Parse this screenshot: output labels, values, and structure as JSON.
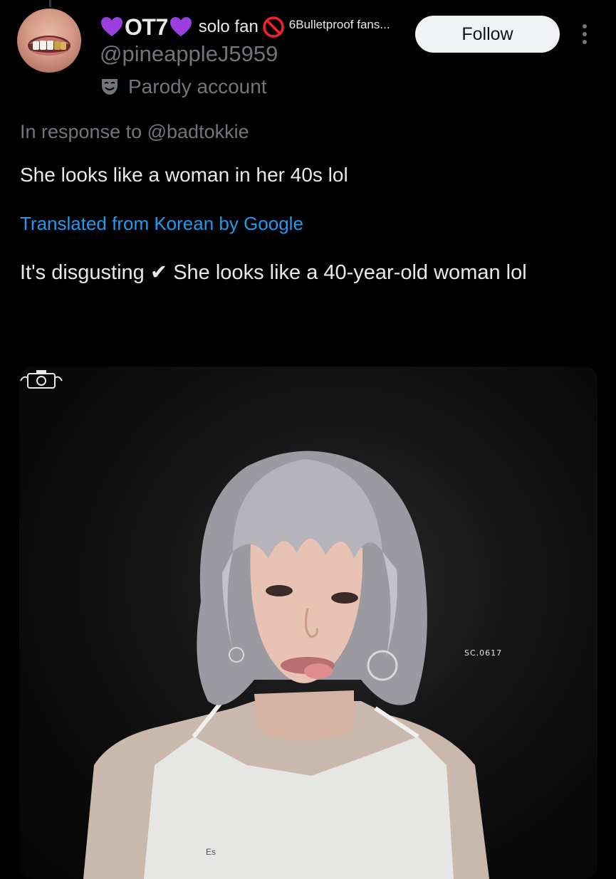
{
  "author": {
    "display_name_parts": {
      "badge_text": "OT7",
      "solo_text": "solo fan",
      "bulletproof_text": "6Bulletproof fans..."
    },
    "handle": "@pineappleJ5959",
    "parody_label": "Parody account",
    "follow_label": "Follow"
  },
  "post": {
    "reply_context": "In response to @badtokkie",
    "original_text": "She looks like a woman in her 40s lol",
    "translation_link": "Translated from Korean by Google",
    "translated_text": "It's disgusting ✔ She looks like a 40-year-old woman lol"
  },
  "media": {
    "watermark_text": "SC.0617",
    "shirt_text": "Es"
  },
  "colors": {
    "background": "#000000",
    "text_primary": "#e7e9ea",
    "text_secondary": "#71767b",
    "link": "#1d9bf0",
    "heart": "#9b3ee0",
    "no_sign": "#f4212e",
    "follow_bg": "#eff3f4"
  },
  "icons": {
    "heart": "purple-heart-icon",
    "no_sign": "prohibited-icon",
    "parody": "theater-mask-icon",
    "more": "more-vertical-icon"
  }
}
